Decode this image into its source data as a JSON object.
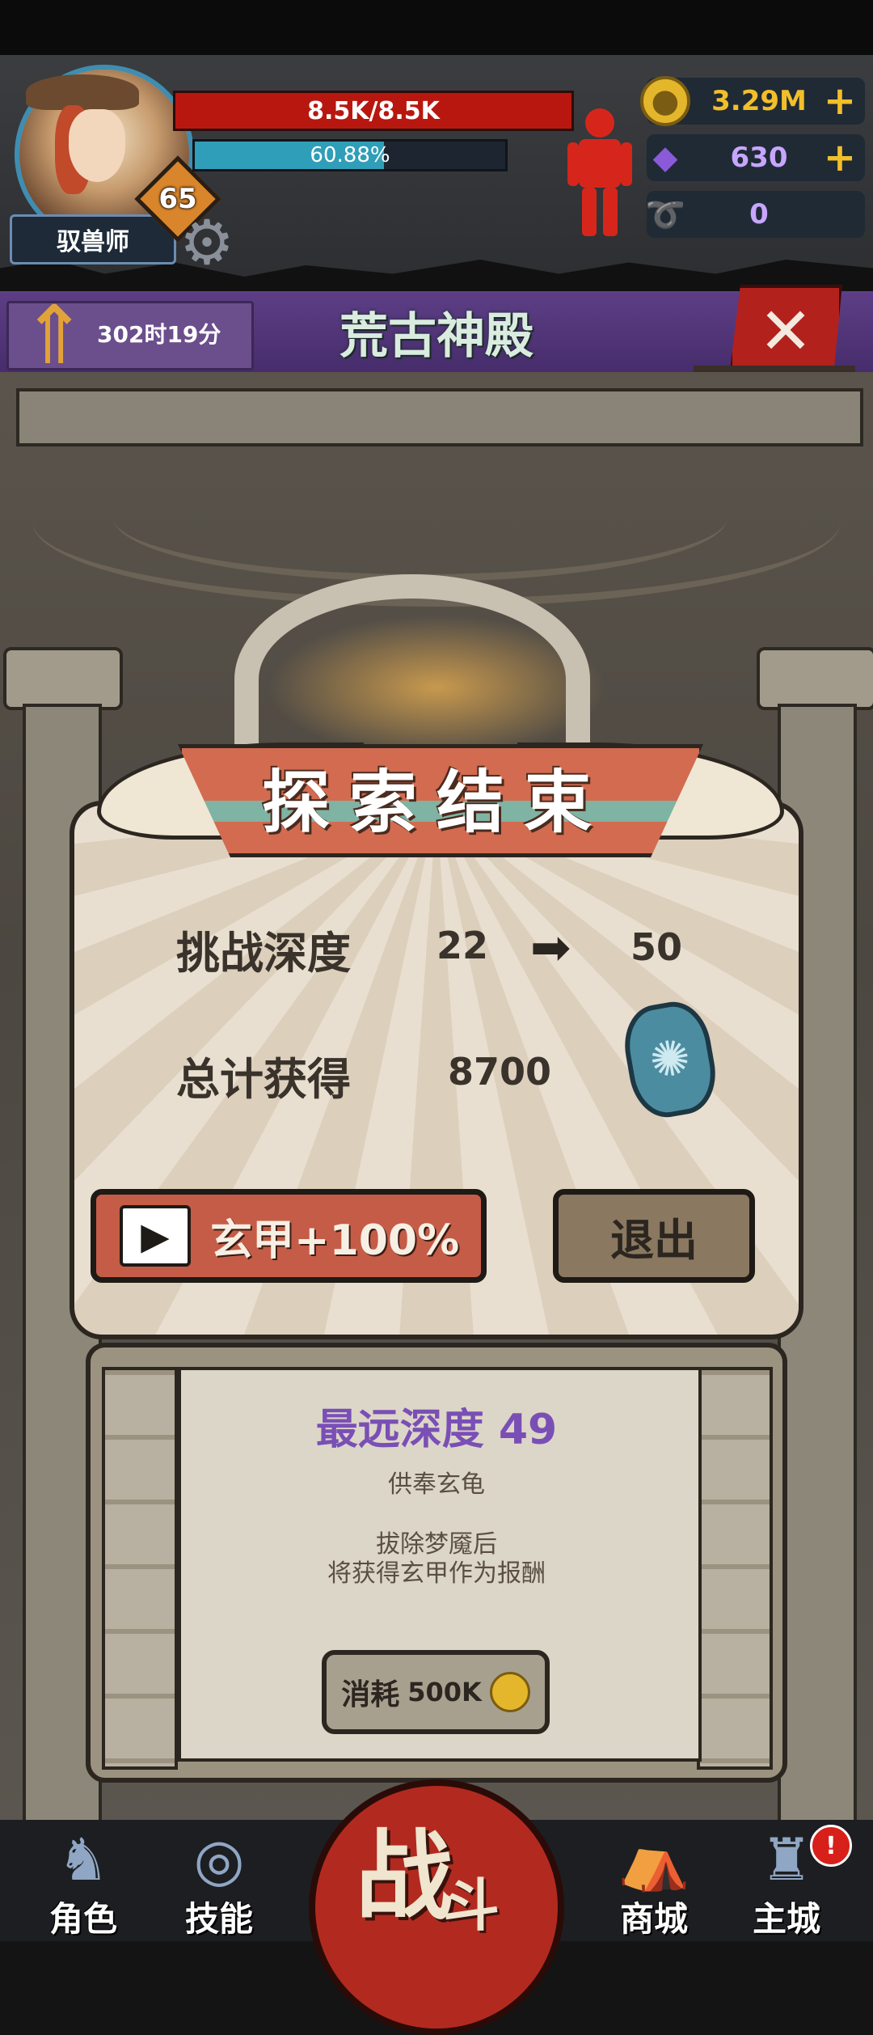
{
  "player": {
    "class_name": "驭兽师",
    "level": "65",
    "hp_text": "8.5K/8.5K",
    "xp_text": "60.88%",
    "xp_progress": 0.6088
  },
  "resources": {
    "gold": "3.29M",
    "gems": "630",
    "horns": "0"
  },
  "icons": {
    "gold": "gold-coin-icon",
    "gem": "purple-crystal-icon",
    "horn": "ram-horn-icon",
    "settings": "gear-icon",
    "armor": "red-armor-icon",
    "upgrade": "upgrade-arrows-icon",
    "close": "close-icon",
    "video": "video-play-icon",
    "clover": "four-leaf-clover-icon",
    "reward": "shield-gem-icon"
  },
  "stage": {
    "timer": "302时19分",
    "title": "荒古神殿"
  },
  "result": {
    "banner": "探索结束",
    "depth_label": "挑战深度",
    "depth_from": "22",
    "depth_to": "50",
    "total_label": "总计获得",
    "total_value": "8700",
    "video_button": "玄甲+100%",
    "exit_button": "退出"
  },
  "info": {
    "best_depth": "最远深度 49",
    "offering": "供奉玄龟",
    "desc_line1": "拔除梦魇后",
    "desc_line2": "将获得玄甲作为报酬",
    "cost_label": "消耗",
    "cost_value": "500K"
  },
  "nav": {
    "character": "角色",
    "skills": "技能",
    "fight_big": "战",
    "fight_small": "斗",
    "shop": "商城",
    "main_city": "主城",
    "alert": "!"
  },
  "colors": {
    "hp": "#b8170f",
    "xp": "#2f9eb8",
    "title_band": "#5d3e86",
    "video_button": "#c55c47",
    "depth_title": "#7a4fb5",
    "gold_text": "#f2bf2a",
    "gem_text": "#c7a6ff"
  }
}
